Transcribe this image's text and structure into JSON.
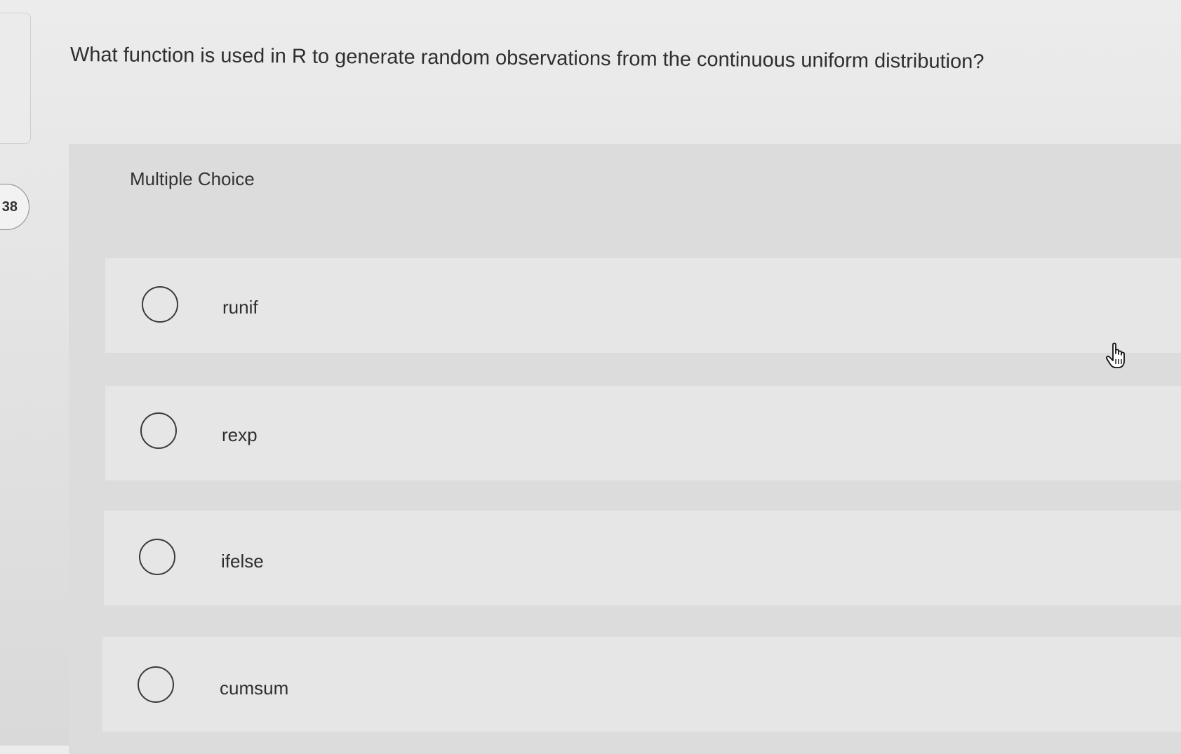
{
  "question_number": "38",
  "question_text": "What function is used in R to generate random observations from the continuous uniform distribution?",
  "question_type_label": "Multiple Choice",
  "options": [
    {
      "label": "runif"
    },
    {
      "label": "rexp"
    },
    {
      "label": "ifelse"
    },
    {
      "label": "cumsum"
    }
  ],
  "cursor_icon": "hand-pointer-icon"
}
